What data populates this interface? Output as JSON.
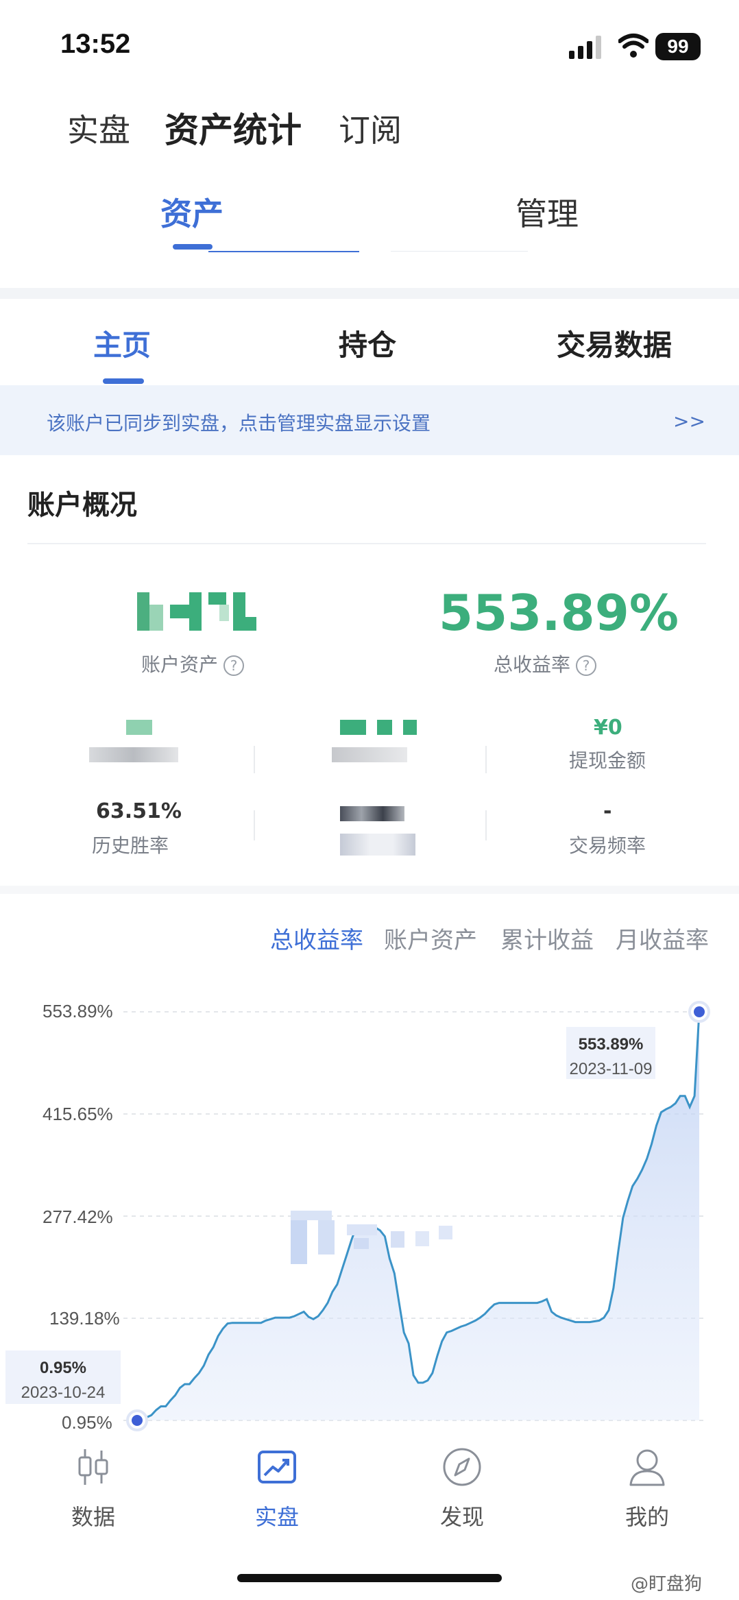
{
  "status_bar": {
    "time": "13:52",
    "battery": "99"
  },
  "top_tabs": [
    {
      "label": "实盘",
      "active": false
    },
    {
      "label": "资产统计",
      "active": true
    },
    {
      "label": "订阅",
      "active": false
    }
  ],
  "segment_tabs": [
    {
      "label": "资产",
      "active": true
    },
    {
      "label": "管理",
      "active": false
    }
  ],
  "sub_tabs": [
    {
      "label": "主页",
      "active": true
    },
    {
      "label": "持仓",
      "active": false
    },
    {
      "label": "交易数据",
      "active": false
    }
  ],
  "notice": {
    "text": "该账户已同步到实盘，点击管理实盘显示设置",
    "arrow": ">>"
  },
  "overview": {
    "title": "账户概况",
    "account_asset_label": "账户资产",
    "total_return_value": "553.89%",
    "total_return_label": "总收益率",
    "help_glyph": "?",
    "withdraw_value": "¥0",
    "withdraw_label": "提现金额",
    "win_rate_value": "63.51%",
    "win_rate_label": "历史胜率",
    "trade_freq_value": "-",
    "trade_freq_label": "交易频率"
  },
  "chart_tabs": [
    {
      "label": "总收益率",
      "active": true
    },
    {
      "label": "账户资产",
      "active": false
    },
    {
      "label": "累计收益",
      "active": false
    },
    {
      "label": "月收益率",
      "active": false
    }
  ],
  "chart_data": {
    "type": "area",
    "y_ticks": [
      "553.89%",
      "415.65%",
      "277.42%",
      "139.18%",
      "0.95%"
    ],
    "ylim": [
      0.95,
      553.89
    ],
    "grid": true,
    "x_start": "2023-10-24",
    "x_end": "2023-11-09",
    "series": [
      {
        "values": [
          0.95,
          0.95,
          5,
          8,
          15,
          20,
          20,
          28,
          35,
          45,
          50,
          50,
          58,
          65,
          75,
          90,
          100,
          115,
          125,
          132,
          133,
          133,
          133,
          133,
          133,
          133,
          133,
          136,
          138,
          140,
          140,
          140,
          140,
          142,
          145,
          148,
          141,
          138,
          142,
          150,
          160,
          175,
          185,
          205,
          225,
          245,
          263,
          262,
          260,
          263,
          262,
          258,
          250,
          220,
          200,
          160,
          120,
          105,
          62,
          52,
          52,
          55,
          65,
          88,
          108,
          120,
          122,
          125,
          128,
          130,
          133,
          136,
          140,
          145,
          152,
          158,
          160,
          160,
          160,
          160,
          160,
          160,
          160,
          160,
          160,
          162,
          165,
          148,
          143,
          140,
          138,
          136,
          134,
          134,
          134,
          134,
          135,
          136,
          140,
          150,
          180,
          230,
          275,
          298,
          318,
          328,
          340,
          355,
          375,
          400,
          418,
          422,
          425,
          430,
          440,
          440,
          425,
          440,
          553.89
        ]
      }
    ],
    "tooltips": [
      {
        "value": "553.89%",
        "date": "2023-11-09"
      },
      {
        "value": "0.95%",
        "date": "2023-10-24"
      }
    ]
  },
  "bottom_nav": [
    {
      "label": "数据",
      "icon": "candlestick-icon",
      "active": false
    },
    {
      "label": "实盘",
      "icon": "trend-chart-icon",
      "active": true
    },
    {
      "label": "发现",
      "icon": "compass-icon",
      "active": false
    },
    {
      "label": "我的",
      "icon": "user-icon",
      "active": false
    }
  ],
  "watermark": "@盯盘狗"
}
